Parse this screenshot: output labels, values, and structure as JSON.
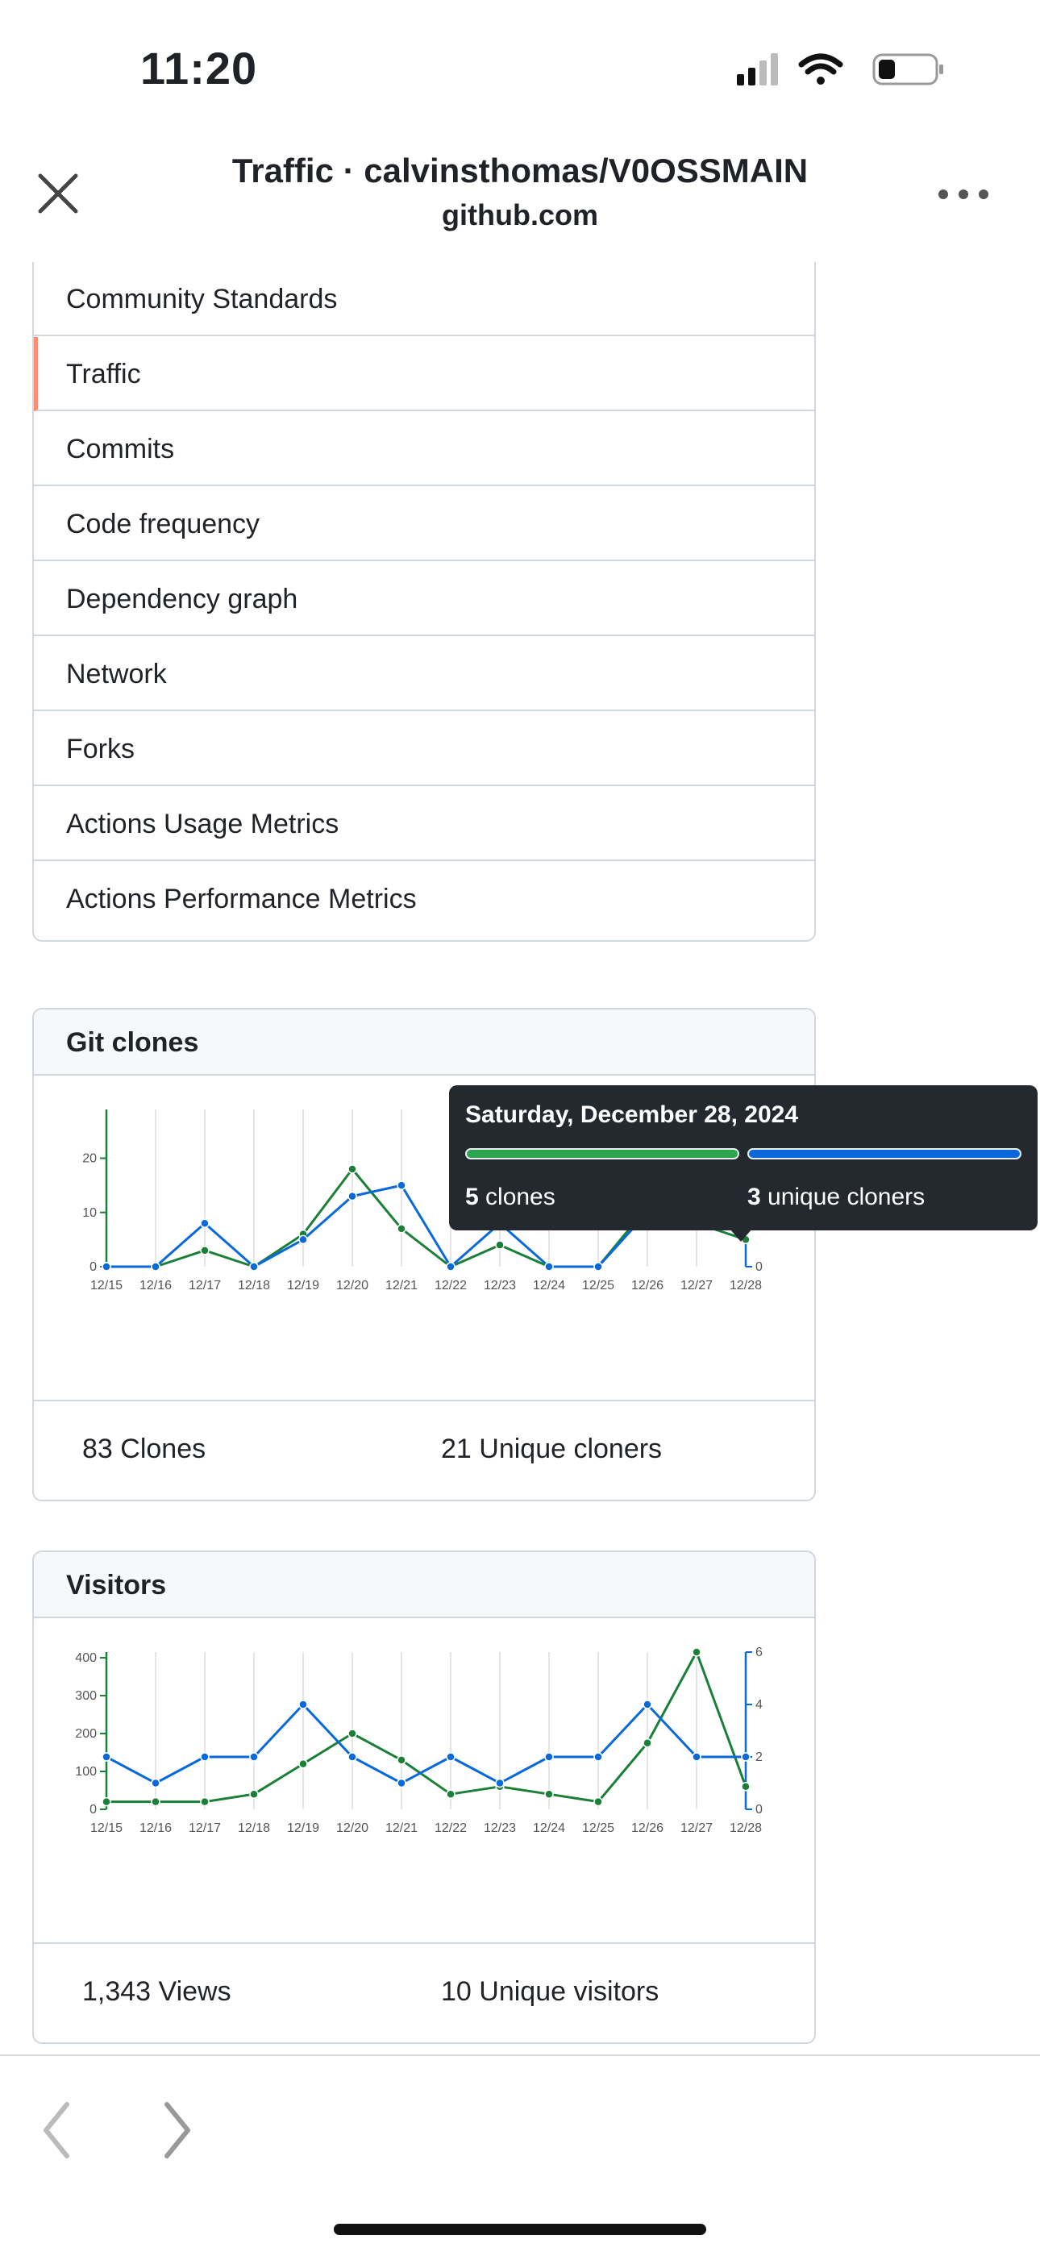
{
  "status": {
    "time": "11:20"
  },
  "header": {
    "title": "Traffic · calvinsthomas/V0OSSMAIN",
    "subtitle": "github.com"
  },
  "menu": {
    "items": [
      {
        "label": "Community Standards",
        "active": false
      },
      {
        "label": "Traffic",
        "active": true
      },
      {
        "label": "Commits",
        "active": false
      },
      {
        "label": "Code frequency",
        "active": false
      },
      {
        "label": "Dependency graph",
        "active": false
      },
      {
        "label": "Network",
        "active": false
      },
      {
        "label": "Forks",
        "active": false
      },
      {
        "label": "Actions Usage Metrics",
        "active": false
      },
      {
        "label": "Actions Performance Metrics",
        "active": false
      }
    ]
  },
  "clones": {
    "title": "Git clones",
    "total_label": "83 Clones",
    "unique_label": "21 Unique cloners",
    "tooltip": {
      "date": "Saturday, December 28, 2024",
      "clones_value": "5",
      "clones_text": " clones",
      "cloners_value": "3",
      "cloners_text": " unique cloners"
    }
  },
  "visitors": {
    "title": "Visitors",
    "total_label": "1,343 Views",
    "unique_label": "10 Unique visitors"
  },
  "colors": {
    "green": "#1a7f37",
    "blue": "#0969da",
    "active_marker": "#fd8c73"
  },
  "chart_data": [
    {
      "type": "line",
      "title": "Git clones",
      "x": [
        "12/15",
        "12/16",
        "12/17",
        "12/18",
        "12/19",
        "12/20",
        "12/21",
        "12/22",
        "12/23",
        "12/24",
        "12/25",
        "12/26",
        "12/27",
        "12/28"
      ],
      "y_ticks": [
        0,
        10,
        20
      ],
      "ylim": [
        0,
        29
      ],
      "series": [
        {
          "name": "clones",
          "color": "#1a7f37",
          "values": [
            0,
            0,
            3,
            0,
            6,
            18,
            7,
            0,
            4,
            0,
            0,
            11,
            null,
            5
          ]
        },
        {
          "name": "unique cloners",
          "color": "#0969da",
          "values": [
            0,
            0,
            8,
            0,
            5,
            13,
            15,
            0,
            8,
            0,
            0,
            10,
            null,
            8
          ]
        }
      ],
      "right_axis_ticks": [
        0
      ]
    },
    {
      "type": "line",
      "title": "Visitors",
      "x": [
        "12/15",
        "12/16",
        "12/17",
        "12/18",
        "12/19",
        "12/20",
        "12/21",
        "12/22",
        "12/23",
        "12/24",
        "12/25",
        "12/26",
        "12/27",
        "12/28"
      ],
      "y_ticks": [
        0,
        100,
        200,
        300,
        400
      ],
      "ylim": [
        0,
        415
      ],
      "y2_ticks": [
        0,
        2,
        4,
        6
      ],
      "y2lim": [
        0,
        6
      ],
      "series": [
        {
          "name": "views",
          "axis": "left",
          "color": "#1a7f37",
          "values": [
            20,
            20,
            20,
            40,
            120,
            200,
            130,
            40,
            60,
            40,
            20,
            175,
            415,
            60
          ]
        },
        {
          "name": "unique visitors",
          "axis": "right",
          "color": "#0969da",
          "values": [
            2,
            1,
            2,
            2,
            4,
            2,
            1,
            2,
            1,
            2,
            2,
            4,
            2,
            2
          ]
        }
      ]
    }
  ]
}
